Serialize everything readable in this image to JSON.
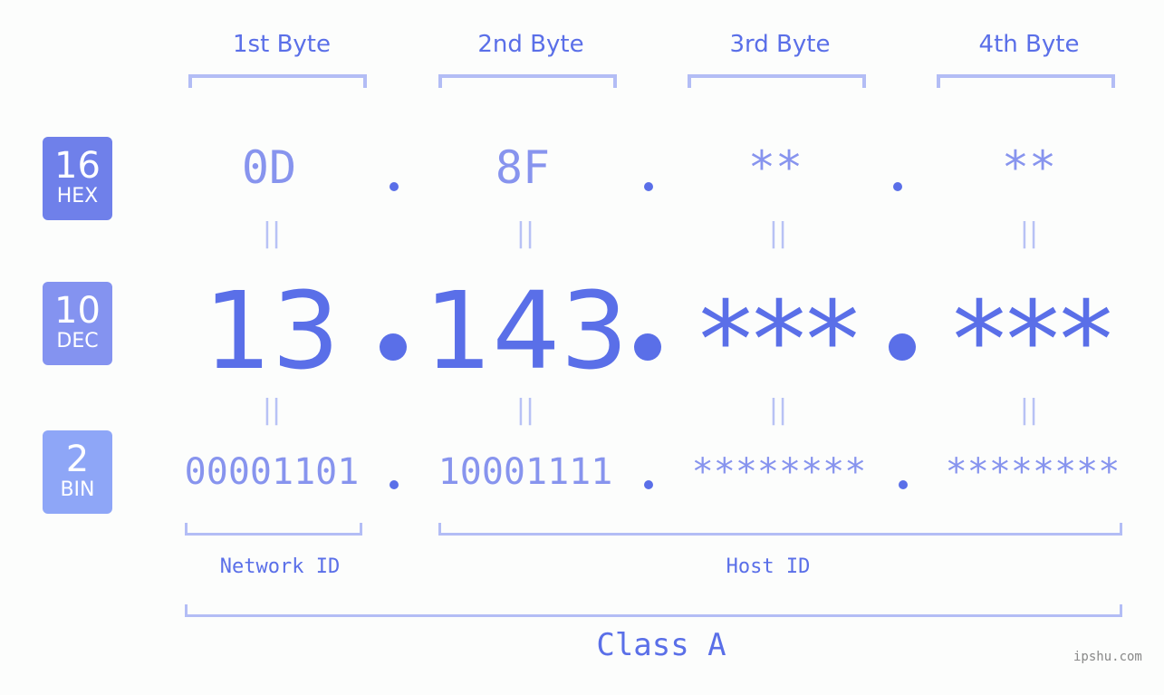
{
  "ip": {
    "bytes": [
      "1st Byte",
      "2nd Byte",
      "3rd Byte",
      "4th Byte"
    ],
    "hex": [
      "0D",
      "8F",
      "**",
      "**"
    ],
    "dec": [
      "13",
      "143",
      "***",
      "***"
    ],
    "bin": [
      "00001101",
      "10001111",
      "********",
      "********"
    ],
    "equals_glyph": "||"
  },
  "badges": {
    "hex": {
      "num": "16",
      "label": "HEX",
      "color": "#6f80ea"
    },
    "dec": {
      "num": "10",
      "label": "DEC",
      "color": "#8493f0"
    },
    "bin": {
      "num": "2",
      "label": "BIN",
      "color": "#8ea6f7"
    }
  },
  "segments": {
    "network": "Network ID",
    "host": "Host ID",
    "class": "Class A"
  },
  "colors": {
    "accent": "#5a6fe8",
    "light": "#8794ee",
    "bracket": "#b3bdf5"
  },
  "watermark": "ipshu.com"
}
